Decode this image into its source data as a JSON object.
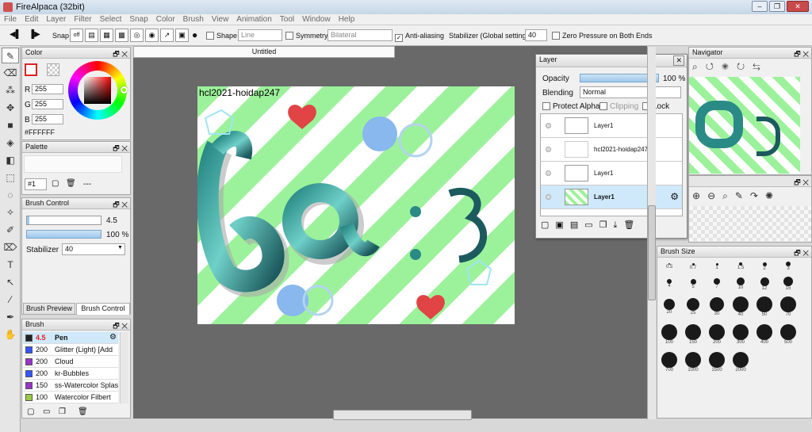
{
  "app": {
    "title": "FireAlpaca (32bit)"
  },
  "menu": [
    "File",
    "Edit",
    "Layer",
    "Filter",
    "Select",
    "Snap",
    "Color",
    "Brush",
    "View",
    "Animation",
    "Tool",
    "Window",
    "Help"
  ],
  "toolbar": {
    "snap_label": "Snap",
    "snap_off": "off",
    "shape_label": "Shape",
    "shape_value": "Line",
    "symmetry_label": "Symmetry",
    "symmetry_value": "Bilateral",
    "antialias_label": "Anti-aliasing",
    "stabilizer_label": "Stabilizer (Global settings)",
    "stabilizer_value": "40",
    "zero_pressure_label": "Zero Pressure on Both Ends"
  },
  "color_panel": {
    "title": "Color",
    "r_label": "R",
    "r": "255",
    "g_label": "G",
    "g": "255",
    "b_label": "B",
    "b": "255",
    "hex": "#FFFFFF"
  },
  "palette_panel": {
    "title": "Palette",
    "index": "#1",
    "dash": "---"
  },
  "brush_control": {
    "title": "Brush Control",
    "size": "4.5",
    "opacity": "100 %",
    "stabilizer_label": "Stabilizer",
    "stabilizer_value": "40",
    "tab_preview": "Brush Preview",
    "tab_control": "Brush Control"
  },
  "brush_panel": {
    "title": "Brush",
    "items": [
      {
        "size": "4.5",
        "name": "Pen",
        "color": "#222222"
      },
      {
        "size": "200",
        "name": "Glitter (Light) [Add",
        "color": "#3355ff"
      },
      {
        "size": "200",
        "name": "Cloud",
        "color": "#9933cc"
      },
      {
        "size": "200",
        "name": "kr-Bubbles",
        "color": "#3355ff"
      },
      {
        "size": "150",
        "name": "ss-Watercolor Splas",
        "color": "#9933cc"
      },
      {
        "size": "100",
        "name": "Watercolor Filbert",
        "color": "#99cc44"
      }
    ]
  },
  "document": {
    "tab_title": "Untitled",
    "canvas_text": "hcl2021-hoidap247"
  },
  "layer_panel": {
    "title": "Layer",
    "opacity_label": "Opacity",
    "opacity_value": "100 %",
    "blending_label": "Blending",
    "blending_value": "Normal",
    "protect_alpha": "Protect Alpha",
    "clipping": "Clipping",
    "lock": "Lock",
    "layers": [
      {
        "name": "Layer1",
        "selected": false
      },
      {
        "name": "hcl2021-hoidap247",
        "selected": false
      },
      {
        "name": "Layer1",
        "selected": false
      },
      {
        "name": "Layer1",
        "selected": true
      }
    ]
  },
  "navigator": {
    "title": "Navigator"
  },
  "brush_size_panel": {
    "title": "Brush Size",
    "sizes": [
      "0.5",
      "0.7",
      "1",
      "1.5",
      "2",
      "3",
      "4",
      "5",
      "7",
      "10",
      "12",
      "15",
      "20",
      "25",
      "30",
      "40",
      "50",
      "70",
      "100",
      "150",
      "200",
      "300",
      "400",
      "500",
      "700",
      "1000",
      "1500",
      "2000"
    ]
  },
  "colors": {
    "accent": "#9fd2f3",
    "canvas_green": "#9cf29a",
    "background": "#696969"
  }
}
